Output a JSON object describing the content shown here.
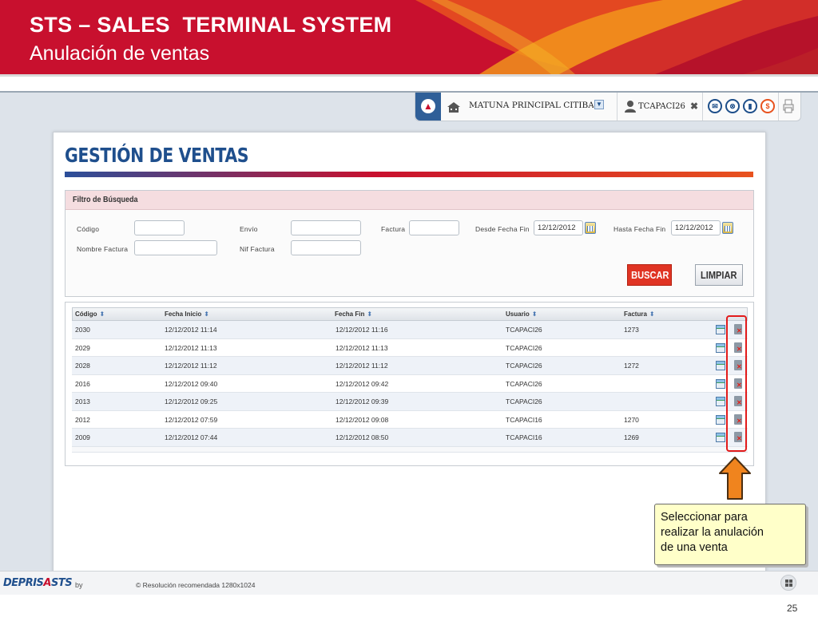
{
  "slide": {
    "title": "STS – SALES  TERMINAL SYSTEM",
    "subtitle": "Anulación de ventas",
    "page_number": "25"
  },
  "colors": {
    "brand_red": "#c8102e",
    "brand_blue": "#1f4f8d",
    "accent_orange": "#f0841e",
    "callout_bg": "#ffffc9"
  },
  "toolbar": {
    "branch": "MATUNA PRINCIPAL CITIBANK",
    "user": "TCAPACI26",
    "icons": [
      "home-icon",
      "user-icon",
      "close-icon",
      "mail-icon",
      "cancel-circle-icon",
      "lock-icon",
      "dollar-icon",
      "printer-icon"
    ]
  },
  "page": {
    "title": "GESTIÓN DE VENTAS"
  },
  "filter": {
    "title": "Filtro de Búsqueda",
    "codigo_label": "Código",
    "envio_label": "Envío",
    "factura_label": "Factura",
    "desde_label": "Desde Fecha Fin",
    "desde_value": "12/12/2012",
    "hasta_label": "Hasta Fecha Fin",
    "hasta_value": "12/12/2012",
    "nombre_factura_label": "Nombre Factura",
    "nif_factura_label": "Nif Factura",
    "buscar_label": "BUSCAR",
    "limpiar_label": "LIMPIAR"
  },
  "table": {
    "columns": [
      "Código",
      "Fecha Inicio",
      "Fecha Fin",
      "Usuario",
      "Factura"
    ],
    "sort_glyph": "⬍",
    "rows": [
      [
        "2030",
        "12/12/2012 11:14",
        "12/12/2012 11:16",
        "TCAPACI26",
        "1273"
      ],
      [
        "2029",
        "12/12/2012 11:13",
        "12/12/2012 11:13",
        "TCAPACI26",
        ""
      ],
      [
        "2028",
        "12/12/2012 11:12",
        "12/12/2012 11:12",
        "TCAPACI26",
        "1272"
      ],
      [
        "2016",
        "12/12/2012 09:40",
        "12/12/2012 09:42",
        "TCAPACI26",
        ""
      ],
      [
        "2013",
        "12/12/2012 09:25",
        "12/12/2012 09:39",
        "TCAPACI26",
        ""
      ],
      [
        "2012",
        "12/12/2012 07:59",
        "12/12/2012 09:08",
        "TCAPACI16",
        "1270"
      ],
      [
        "2009",
        "12/12/2012 07:44",
        "12/12/2012 08:50",
        "TCAPACI16",
        "1269"
      ]
    ]
  },
  "callout": {
    "line1": "Seleccionar para",
    "line2": "realizar la anulación",
    "line3": "de una venta"
  },
  "footer": {
    "logo_part1": "DEPRIS",
    "logo_part2": "A",
    "logo_part3": "STS",
    "by": "by",
    "resolution": "© Resolución recomendada 1280x1024"
  }
}
